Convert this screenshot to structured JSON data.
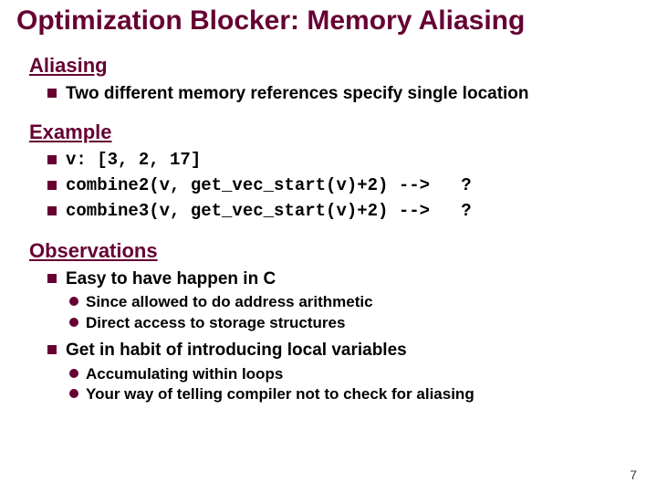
{
  "title": "Optimization Blocker: Memory Aliasing",
  "sections": {
    "aliasing": {
      "head": "Aliasing",
      "items": [
        "Two different memory references specify single location"
      ]
    },
    "example": {
      "head": "Example",
      "code": [
        "v: [3, 2, 17]",
        "combine2(v, get_vec_start(v)+2) -->   ?",
        "combine3(v, get_vec_start(v)+2) -->   ?"
      ]
    },
    "observations": {
      "head": "Observations",
      "points": [
        {
          "text": "Easy to have happen in C",
          "subs": [
            "Since allowed to do address arithmetic",
            "Direct access to storage structures"
          ]
        },
        {
          "text": "Get in habit of introducing local variables",
          "subs": [
            "Accumulating within loops",
            "Your way of telling compiler not to check for aliasing"
          ]
        }
      ]
    }
  },
  "page": "7"
}
